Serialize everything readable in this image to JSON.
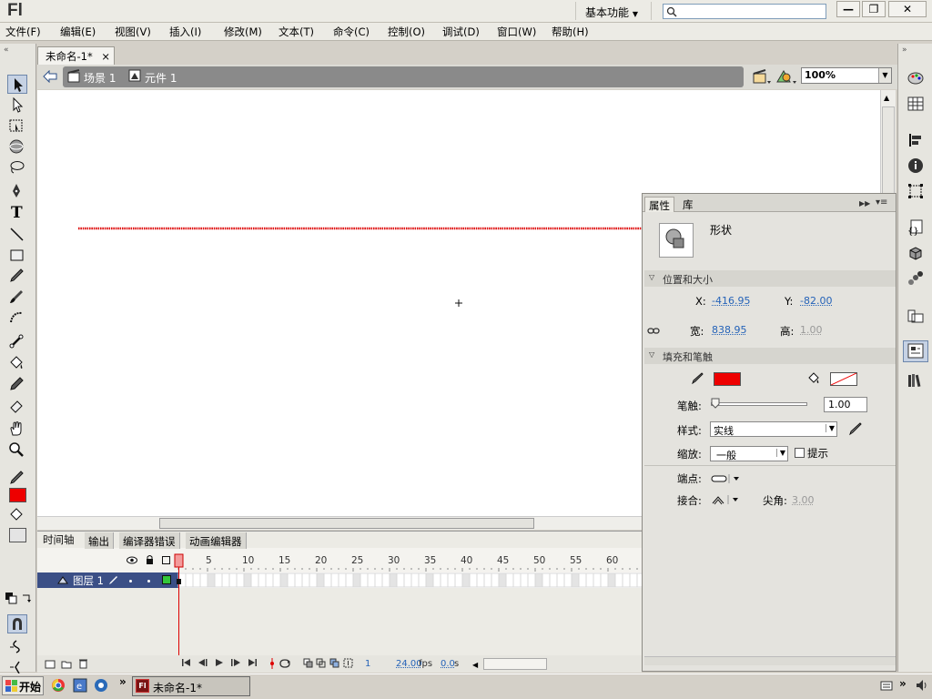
{
  "app": {
    "logo": "Fl",
    "workspace": "基本功能"
  },
  "window": {
    "minimize": "—",
    "restore": "❐",
    "close": "✕"
  },
  "menus": [
    "文件(F)",
    "编辑(E)",
    "视图(V)",
    "插入(I)",
    "修改(M)",
    "文本(T)",
    "命令(C)",
    "控制(O)",
    "调试(D)",
    "窗口(W)",
    "帮助(H)"
  ],
  "document": {
    "tab": "未命名-1*",
    "tab_close": "×"
  },
  "editbar": {
    "scene": "场景 1",
    "symbol": "元件 1",
    "zoom": "100%"
  },
  "colors": {
    "stroke": "#ee0000",
    "fill": "none",
    "line": "#dd0000"
  },
  "timeline": {
    "tabs": [
      "时间轴",
      "输出",
      "编译器错误",
      "动画编辑器"
    ],
    "frame_numbers": [
      "1",
      "5",
      "10",
      "15",
      "20",
      "25",
      "30",
      "35",
      "40",
      "45",
      "50",
      "55",
      "60"
    ],
    "layer_name": "图层 1",
    "current_frame": "1",
    "fps": "24.00",
    "fps_unit": "fps",
    "time": "0.0",
    "time_unit": "s"
  },
  "properties": {
    "tabs": [
      "属性",
      "库"
    ],
    "object_type": "形状",
    "section_position": "位置和大小",
    "x_label": "X:",
    "x_value": "-416.95",
    "y_label": "Y:",
    "y_value": "-82.00",
    "w_label": "宽:",
    "w_value": "838.95",
    "h_label": "高:",
    "h_value": "1.00",
    "section_fill": "填充和笔触",
    "stroke_width_label": "笔触:",
    "stroke_width": "1.00",
    "style_label": "样式:",
    "style_value": "实线",
    "scale_label": "缩放:",
    "scale_value": "一般",
    "hint_label": "提示",
    "cap_label": "端点:",
    "join_label": "接合:",
    "miter_label": "尖角:",
    "miter_value": "3.00"
  },
  "taskbar": {
    "start": "开始",
    "item": "未命名-1*",
    "chevron": "»"
  }
}
